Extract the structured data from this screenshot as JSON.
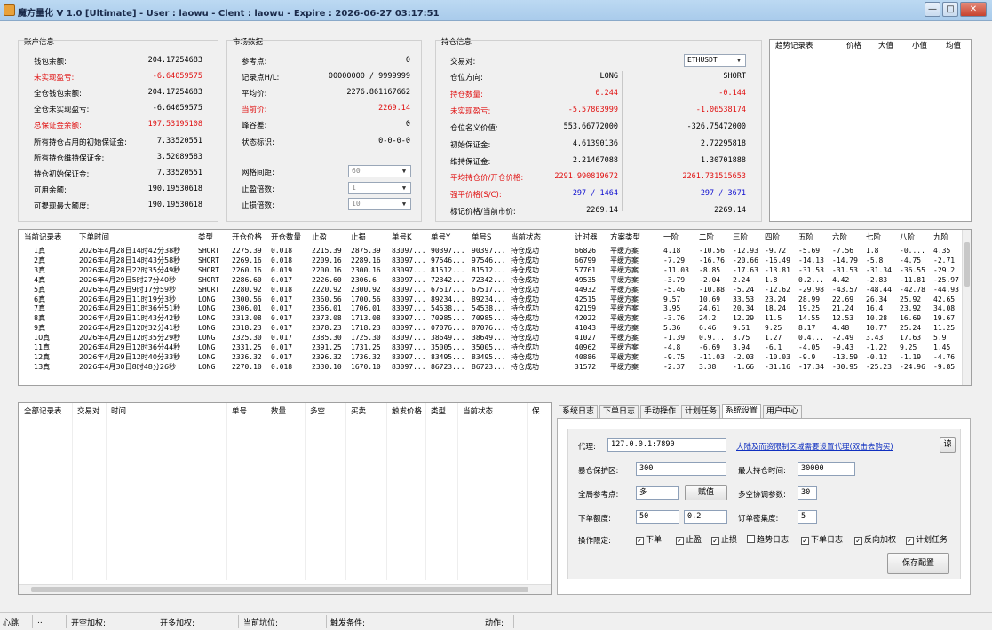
{
  "window": {
    "title": "魔方量化 V 1.0 [Ultimate]   - User : laowu  - Clent : laowu  - Expire : 2026-06-27 03:17:51"
  },
  "account": {
    "title": "账户信息",
    "rows": [
      {
        "label": "钱包余额:",
        "value": "204.17254683",
        "red": false
      },
      {
        "label": "未实现盈亏:",
        "value": "-6.64059575",
        "red": true
      },
      {
        "label": "全仓钱包余额:",
        "value": "204.17254683",
        "red": false
      },
      {
        "label": "全仓未实现盈亏:",
        "value": "-6.64059575",
        "red": false
      },
      {
        "label": "总保证金余额:",
        "value": "197.53195108",
        "red": true
      },
      {
        "label": "所有持仓占用的初始保证金:",
        "value": "7.33520551",
        "red": false
      },
      {
        "label": "所有持仓维持保证金:",
        "value": "3.52089583",
        "red": false
      },
      {
        "label": "持仓初始保证金:",
        "value": "7.33520551",
        "red": false
      },
      {
        "label": "可用余额:",
        "value": "190.19530618",
        "red": false
      },
      {
        "label": "可提现最大额度:",
        "value": "190.19530618",
        "red": false
      }
    ]
  },
  "market": {
    "title": "市场数据",
    "rows": [
      {
        "label": "参考点:",
        "value": "0",
        "red": false
      },
      {
        "label": "记录点H/L:",
        "value": "00000000  /  9999999",
        "red": false
      },
      {
        "label": "平均价:",
        "value": "2276.861167662",
        "red": false
      },
      {
        "label": "当前价:",
        "value": "2269.14",
        "red": true
      },
      {
        "label": "峰谷差:",
        "value": "0",
        "red": false
      },
      {
        "label": "状态标识:",
        "value": "0-0-0-0",
        "red": false
      }
    ],
    "grid_label": "网格间距:",
    "grid_value": "60",
    "tp_label": "止盈倍数:",
    "tp_value": "1",
    "sl_label": "止损倍数:",
    "sl_value": "10"
  },
  "position": {
    "title": "持仓信息",
    "pair_label": "交易对:",
    "pair_value": "ETHUSDT",
    "rows": [
      {
        "label": "仓位方向:",
        "long": "LONG",
        "short": "SHORT",
        "red": false
      },
      {
        "label": "持仓数量:",
        "long": "0.244",
        "short": "-0.144",
        "red": true
      },
      {
        "label": "未实现盈亏:",
        "long": "-5.57803999",
        "short": "-1.06538174",
        "red": true
      },
      {
        "label": "仓位名义价值:",
        "long": "553.66772000",
        "short": "-326.75472000",
        "red": false
      },
      {
        "label": "初始保证金:",
        "long": "4.61390136",
        "short": "2.72295818",
        "red": false
      },
      {
        "label": "维持保证金:",
        "long": "2.21467088",
        "short": "1.30701888",
        "red": false
      },
      {
        "label": "平均持仓价/开仓价格:",
        "long": "2291.990819672",
        "short": "2261.731515653",
        "red": true
      },
      {
        "label": "强平价格(S/C):",
        "long": "297   /    1464",
        "short": "297   /    3671",
        "red": true,
        "blue": true
      },
      {
        "label": "标记价格/当前市价:",
        "long": "2269.14",
        "short": "2269.14",
        "red": false
      }
    ]
  },
  "trend": {
    "headers": [
      "趋势记录表",
      "价格",
      "大值",
      "小值",
      "均值"
    ]
  },
  "current": {
    "headers": [
      "当前记录表",
      "下单时间",
      "类型",
      "开仓价格",
      "开仓数量",
      "止盈",
      "止损",
      "单号K",
      "单号Y",
      "单号S",
      "当前状态",
      "计时器",
      "方案类型",
      "一阶",
      "二阶",
      "三阶",
      "四阶",
      "五阶",
      "六阶",
      "七阶",
      "八阶",
      "九阶"
    ],
    "rows": [
      [
        "1真",
        "2026年4月28日14时42分38秒",
        "SHORT",
        "2275.39",
        "0.018",
        "2215.39",
        "2875.39",
        "83097...",
        "90397...",
        "90397...",
        "持仓成功",
        "66826",
        "平缓方案",
        "4.18",
        "-10.56",
        "-12.93",
        "-9.72",
        "-5.69",
        "-7.56",
        "1.8",
        "-0....",
        "4.35"
      ],
      [
        "2真",
        "2026年4月28日14时43分58秒",
        "SHORT",
        "2269.16",
        "0.018",
        "2209.16",
        "2289.16",
        "83097...",
        "97546...",
        "97546...",
        "持仓成功",
        "66799",
        "平缓方案",
        "-7.29",
        "-16.76",
        "-20.66",
        "-16.49",
        "-14.13",
        "-14.79",
        "-5.8",
        "-4.75",
        "-2.71"
      ],
      [
        "3真",
        "2026年4月28日22时35分49秒",
        "SHORT",
        "2260.16",
        "0.019",
        "2200.16",
        "2300.16",
        "83097...",
        "81512...",
        "81512...",
        "持仓成功",
        "57761",
        "平缓方案",
        "-11.03",
        "-8.85",
        "-17.63",
        "-13.81",
        "-31.53",
        "-31.53",
        "-31.34",
        "-36.55",
        "-29.2"
      ],
      [
        "4真",
        "2026年4月29日5时27分40秒",
        "SHORT",
        "2286.60",
        "0.017",
        "2226.60",
        "2306.6",
        "83097...",
        "72342...",
        "72342...",
        "持仓成功",
        "49535",
        "平缓方案",
        "-3.79",
        "-2.04",
        "2.24",
        "1.8",
        "0.2...",
        "4.42",
        "-2.83",
        "-11.81",
        "-25.97"
      ],
      [
        "5真",
        "2026年4月29日9时17分59秒",
        "SHORT",
        "2280.92",
        "0.018",
        "2220.92",
        "2300.92",
        "83097...",
        "67517...",
        "67517...",
        "持仓成功",
        "44932",
        "平缓方案",
        "-5.46",
        "-10.88",
        "-5.24",
        "-12.62",
        "-29.98",
        "-43.57",
        "-48.44",
        "-42.78",
        "-44.93"
      ],
      [
        "6真",
        "2026年4月29日11时19分3秒",
        "LONG",
        "2300.56",
        "0.017",
        "2360.56",
        "1700.56",
        "83097...",
        "89234...",
        "89234...",
        "持仓成功",
        "42515",
        "平缓方案",
        "9.57",
        "10.69",
        "33.53",
        "23.24",
        "28.99",
        "22.69",
        "26.34",
        "25.92",
        "42.65"
      ],
      [
        "7真",
        "2026年4月29日11时36分51秒",
        "LONG",
        "2306.01",
        "0.017",
        "2366.01",
        "1706.01",
        "83097...",
        "54538...",
        "54538...",
        "持仓成功",
        "42159",
        "平缓方案",
        "3.95",
        "24.61",
        "20.34",
        "18.24",
        "19.25",
        "21.24",
        "16.4",
        "23.92",
        "34.08"
      ],
      [
        "8真",
        "2026年4月29日11时43分42秒",
        "LONG",
        "2313.08",
        "0.017",
        "2373.08",
        "1713.08",
        "83097...",
        "70985...",
        "70985...",
        "持仓成功",
        "42022",
        "平缓方案",
        "-3.76",
        "24.2",
        "12.29",
        "11.5",
        "14.55",
        "12.53",
        "10.28",
        "16.69",
        "19.67"
      ],
      [
        "9真",
        "2026年4月29日12时32分41秒",
        "LONG",
        "2318.23",
        "0.017",
        "2378.23",
        "1718.23",
        "83097...",
        "07076...",
        "07076...",
        "持仓成功",
        "41043",
        "平缓方案",
        "5.36",
        "6.46",
        "9.51",
        "9.25",
        "8.17",
        "4.48",
        "10.77",
        "25.24",
        "11.25"
      ],
      [
        "10真",
        "2026年4月29日12时35分29秒",
        "LONG",
        "2325.30",
        "0.017",
        "2385.30",
        "1725.30",
        "83097...",
        "38649...",
        "38649...",
        "持仓成功",
        "41027",
        "平缓方案",
        "-1.39",
        "0.9...",
        "3.75",
        "1.27",
        "0.4...",
        "-2.49",
        "3.43",
        "17.63",
        "5.9"
      ],
      [
        "11真",
        "2026年4月29日12时36分44秒",
        "LONG",
        "2331.25",
        "0.017",
        "2391.25",
        "1731.25",
        "83097...",
        "35005...",
        "35005...",
        "持仓成功",
        "40962",
        "平缓方案",
        "-4.8",
        "-6.69",
        "3.94",
        "-6.1",
        "-4.05",
        "-9.43",
        "-1.22",
        "9.25",
        "1.45"
      ],
      [
        "12真",
        "2026年4月29日12时40分33秒",
        "LONG",
        "2336.32",
        "0.017",
        "2396.32",
        "1736.32",
        "83097...",
        "83495...",
        "83495...",
        "持仓成功",
        "40886",
        "平缓方案",
        "-9.75",
        "-11.03",
        "-2.03",
        "-10.03",
        "-9.9",
        "-13.59",
        "-0.12",
        "-1.19",
        "-4.76"
      ],
      [
        "13真",
        "2026年4月30日8时48分26秒",
        "LONG",
        "2270.10",
        "0.018",
        "2330.10",
        "1670.10",
        "83097...",
        "86723...",
        "86723...",
        "持仓成功",
        "31572",
        "平缓方案",
        "-2.37",
        "3.38",
        "-1.66",
        "-31.16",
        "-17.34",
        "-30.95",
        "-25.23",
        "-24.96",
        "-9.85"
      ]
    ]
  },
  "all": {
    "headers": [
      "全部记录表",
      "交易对",
      "时间",
      "单号",
      "数量",
      "多空",
      "买卖",
      "触发价格",
      "类型",
      "当前状态",
      "保"
    ]
  },
  "tabs": [
    "系统日志",
    "下单日志",
    "手动操作",
    "计划任务",
    "系统设置",
    "用户中心"
  ],
  "settings": {
    "proxy_label": "代理:",
    "proxy_value": "127.0.0.1:7890",
    "proxy_link": "大陆及而资限制区域需要设置代理(双击去购买)",
    "proxy_btn": "谅",
    "protect_label": "暴仓保护区:",
    "protect_value": "300",
    "maxhold_label": "最大持仓时间:",
    "maxhold_value": "30000",
    "ref_label": "全局参考点:",
    "ref_value": "多",
    "assign_btn": "赋值",
    "coop_label": "多空协调参数:",
    "coop_value": "30",
    "amount_label": "下单额度:",
    "amount_value1": "50",
    "amount_value2": "0.2",
    "density_label": "订单密集度:",
    "density_value": "5",
    "ops_label": "操作限定:",
    "checks": [
      {
        "label": "下单",
        "checked": true
      },
      {
        "label": "止盈",
        "checked": true
      },
      {
        "label": "止损",
        "checked": true
      },
      {
        "label": "趋势日志",
        "checked": false
      },
      {
        "label": "下单日志",
        "checked": true
      },
      {
        "label": "反向加权",
        "checked": true
      },
      {
        "label": "计划任务",
        "checked": true
      }
    ],
    "save_btn": "保存配置"
  },
  "status": {
    "heartbeat": "心跳:",
    "heartbeat_val": "..",
    "open_weight": "开空加权:",
    "open_more": "开多加权:",
    "pit": "当前坑位:",
    "trigger": "触发条件:",
    "action": "动作:"
  }
}
